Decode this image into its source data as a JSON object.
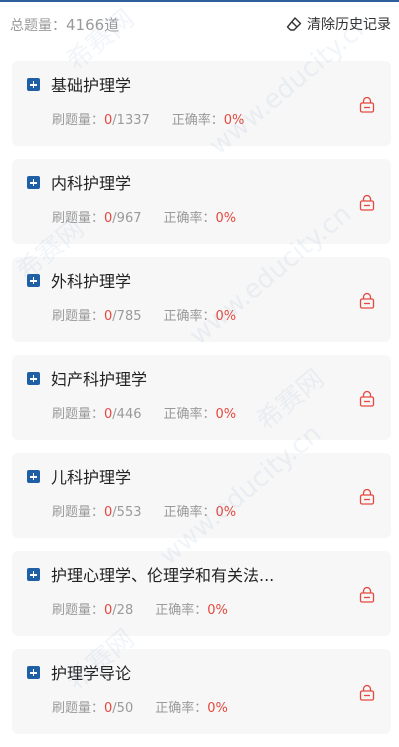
{
  "header": {
    "total_label": "总题量：",
    "total_count": "4166道",
    "clear_label": "清除历史记录"
  },
  "labels": {
    "done": "刷题量：",
    "accuracy": "正确率："
  },
  "subjects": [
    {
      "title": "基础护理学",
      "done": "0",
      "total": "/1337",
      "accuracy": "0%"
    },
    {
      "title": "内科护理学",
      "done": "0",
      "total": "/967",
      "accuracy": "0%"
    },
    {
      "title": "外科护理学",
      "done": "0",
      "total": "/785",
      "accuracy": "0%"
    },
    {
      "title": "妇产科护理学",
      "done": "0",
      "total": "/446",
      "accuracy": "0%"
    },
    {
      "title": "儿科护理学",
      "done": "0",
      "total": "/553",
      "accuracy": "0%"
    },
    {
      "title": "护理心理学、伦理学和有关法...",
      "done": "0",
      "total": "/28",
      "accuracy": "0%"
    },
    {
      "title": "护理学导论",
      "done": "0",
      "total": "/50",
      "accuracy": "0%"
    }
  ],
  "watermark": {
    "url": "www.educity.cn",
    "brand": "希赛网"
  },
  "colors": {
    "accent_blue": "#1f5fa6",
    "red": "#e5483e",
    "card_bg": "#f7f7f7"
  }
}
